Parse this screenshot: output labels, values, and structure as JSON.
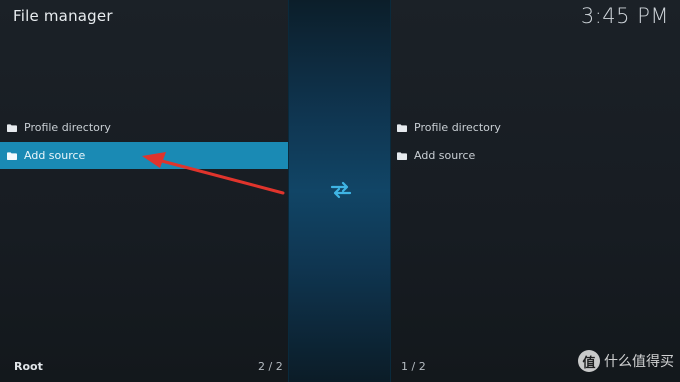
{
  "header": {
    "title": "File manager",
    "clock": "3:45 PM"
  },
  "left_pane": {
    "items": [
      {
        "label": "Profile directory",
        "icon": "folder-icon",
        "selected": false
      },
      {
        "label": "Add source",
        "icon": "folder-icon",
        "selected": true
      }
    ],
    "footer_label": "Root",
    "count": "2 / 2"
  },
  "right_pane": {
    "items": [
      {
        "label": "Profile directory",
        "icon": "folder-icon"
      },
      {
        "label": "Add source",
        "icon": "folder-icon"
      }
    ],
    "count": "1 / 2"
  },
  "center": {
    "icon": "swap-arrows-icon"
  },
  "annotation": {
    "icon": "red-arrow-annotation",
    "color": "#e0342c"
  },
  "watermark": {
    "badge": "值",
    "text": "什么值得买"
  },
  "colors": {
    "accent": "#1a8ab4",
    "background": "#161b20",
    "center_strip": "#114566"
  }
}
